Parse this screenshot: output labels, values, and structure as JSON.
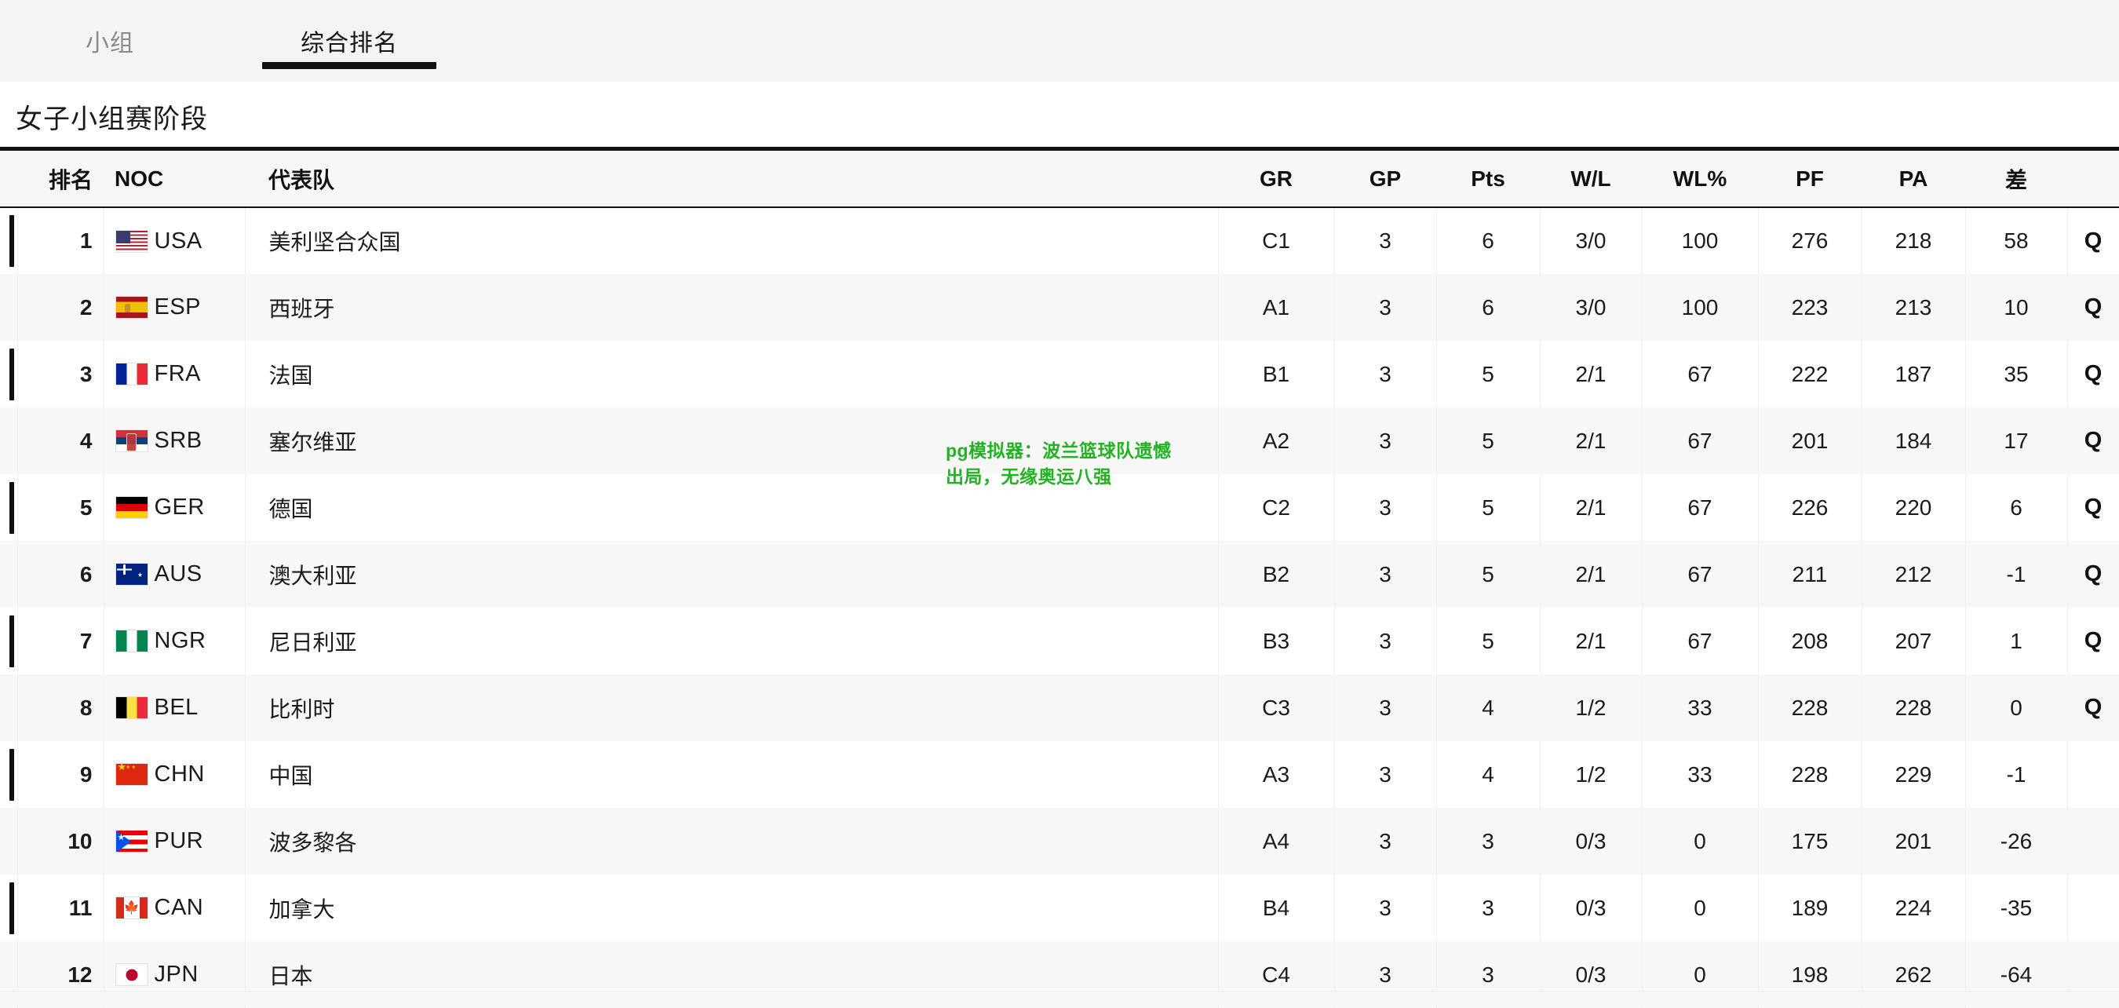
{
  "tabs": [
    {
      "id": "groups",
      "label": "小组",
      "active": false
    },
    {
      "id": "overall",
      "label": "综合排名",
      "active": true
    }
  ],
  "page_title": "女子小组赛阶段",
  "accent_color": "#111111",
  "watermark": {
    "text": "pg模拟器：波兰篮球队遗憾出局，无缘奥运八强",
    "color": "#22b222"
  },
  "table": {
    "headers": {
      "rank": "排名",
      "noc": "NOC",
      "team": "代表队",
      "gr": "GR",
      "gp": "GP",
      "pts": "Pts",
      "wl": "W/L",
      "wlpct": "WL%",
      "pf": "PF",
      "pa": "PA",
      "diff": "差",
      "qual": ""
    },
    "qualified_badge": "Q",
    "rows": [
      {
        "rank": "1",
        "flag": "usa",
        "noc": "USA",
        "team": "美利坚合众国",
        "gr": "C1",
        "gp": "3",
        "pts": "6",
        "wl": "3/0",
        "wlpct": "100",
        "pf": "276",
        "pa": "218",
        "diff": "58",
        "qual": "Q"
      },
      {
        "rank": "2",
        "flag": "esp",
        "noc": "ESP",
        "team": "西班牙",
        "gr": "A1",
        "gp": "3",
        "pts": "6",
        "wl": "3/0",
        "wlpct": "100",
        "pf": "223",
        "pa": "213",
        "diff": "10",
        "qual": "Q"
      },
      {
        "rank": "3",
        "flag": "fra",
        "noc": "FRA",
        "team": "法国",
        "gr": "B1",
        "gp": "3",
        "pts": "5",
        "wl": "2/1",
        "wlpct": "67",
        "pf": "222",
        "pa": "187",
        "diff": "35",
        "qual": "Q"
      },
      {
        "rank": "4",
        "flag": "srb",
        "noc": "SRB",
        "team": "塞尔维亚",
        "gr": "A2",
        "gp": "3",
        "pts": "5",
        "wl": "2/1",
        "wlpct": "67",
        "pf": "201",
        "pa": "184",
        "diff": "17",
        "qual": "Q"
      },
      {
        "rank": "5",
        "flag": "ger",
        "noc": "GER",
        "team": "德国",
        "gr": "C2",
        "gp": "3",
        "pts": "5",
        "wl": "2/1",
        "wlpct": "67",
        "pf": "226",
        "pa": "220",
        "diff": "6",
        "qual": "Q"
      },
      {
        "rank": "6",
        "flag": "aus",
        "noc": "AUS",
        "team": "澳大利亚",
        "gr": "B2",
        "gp": "3",
        "pts": "5",
        "wl": "2/1",
        "wlpct": "67",
        "pf": "211",
        "pa": "212",
        "diff": "-1",
        "qual": "Q"
      },
      {
        "rank": "7",
        "flag": "ngr",
        "noc": "NGR",
        "team": "尼日利亚",
        "gr": "B3",
        "gp": "3",
        "pts": "5",
        "wl": "2/1",
        "wlpct": "67",
        "pf": "208",
        "pa": "207",
        "diff": "1",
        "qual": "Q"
      },
      {
        "rank": "8",
        "flag": "bel",
        "noc": "BEL",
        "team": "比利时",
        "gr": "C3",
        "gp": "3",
        "pts": "4",
        "wl": "1/2",
        "wlpct": "33",
        "pf": "228",
        "pa": "228",
        "diff": "0",
        "qual": "Q"
      },
      {
        "rank": "9",
        "flag": "chn",
        "noc": "CHN",
        "team": "中国",
        "gr": "A3",
        "gp": "3",
        "pts": "4",
        "wl": "1/2",
        "wlpct": "33",
        "pf": "228",
        "pa": "229",
        "diff": "-1",
        "qual": ""
      },
      {
        "rank": "10",
        "flag": "pur",
        "noc": "PUR",
        "team": "波多黎各",
        "gr": "A4",
        "gp": "3",
        "pts": "3",
        "wl": "0/3",
        "wlpct": "0",
        "pf": "175",
        "pa": "201",
        "diff": "-26",
        "qual": ""
      },
      {
        "rank": "11",
        "flag": "can",
        "noc": "CAN",
        "team": "加拿大",
        "gr": "B4",
        "gp": "3",
        "pts": "3",
        "wl": "0/3",
        "wlpct": "0",
        "pf": "189",
        "pa": "224",
        "diff": "-35",
        "qual": ""
      },
      {
        "rank": "12",
        "flag": "jpn",
        "noc": "JPN",
        "team": "日本",
        "gr": "C4",
        "gp": "3",
        "pts": "3",
        "wl": "0/3",
        "wlpct": "0",
        "pf": "198",
        "pa": "262",
        "diff": "-64",
        "qual": ""
      }
    ]
  }
}
